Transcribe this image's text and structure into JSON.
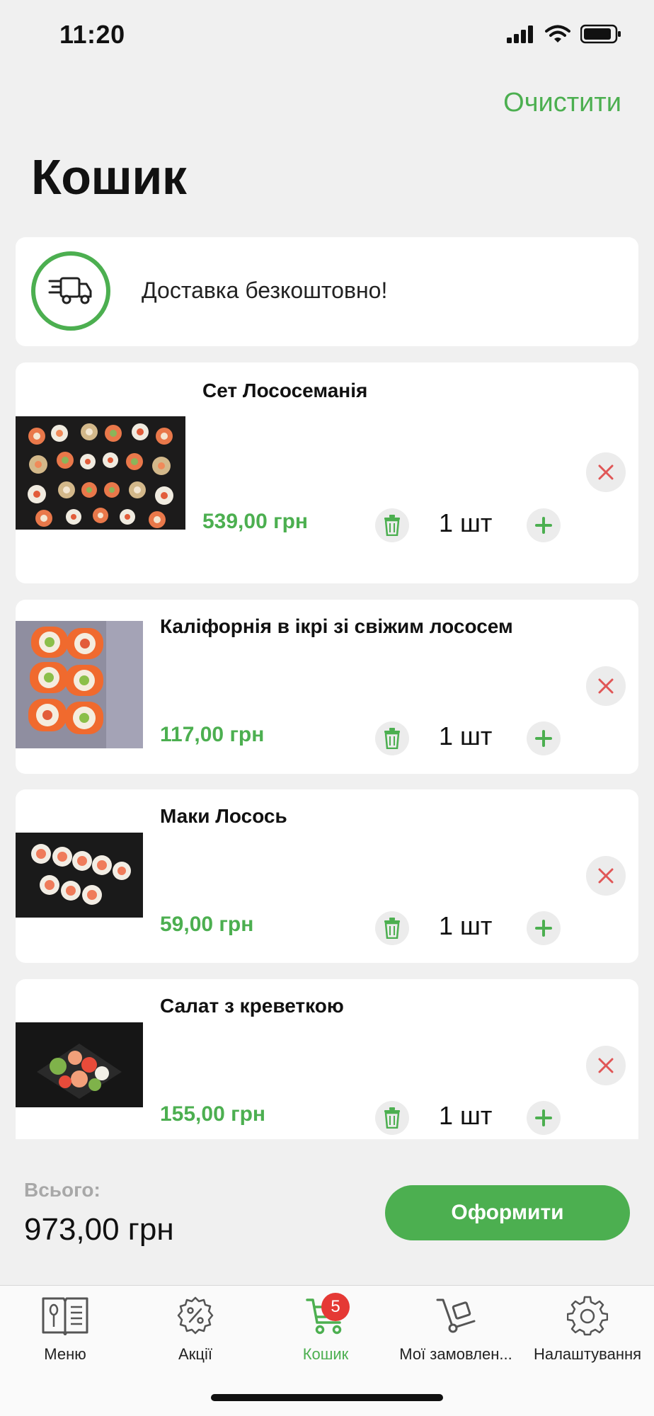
{
  "status_bar": {
    "time": "11:20"
  },
  "header": {
    "clear_label": "Очистити",
    "title": "Кошик"
  },
  "delivery": {
    "text": "Доставка безкоштовно!"
  },
  "items": [
    {
      "name": "Сет Лососеманія",
      "price": "539,00 грн",
      "quantity": "1 шт"
    },
    {
      "name": "Каліфорнія в ікрі  зі свіжим лососем",
      "price": "117,00 грн",
      "quantity": "1 шт"
    },
    {
      "name": "Маки Лосось",
      "price": "59,00 грн",
      "quantity": "1 шт"
    },
    {
      "name": "Салат з креветкою",
      "price": "155,00 грн",
      "quantity": "1 шт"
    }
  ],
  "summary": {
    "total_label": "Всього:",
    "total_value": "973,00 грн",
    "checkout_label": "Оформити"
  },
  "tabs": [
    {
      "label": "Меню",
      "icon": "menu-book-icon"
    },
    {
      "label": "Акції",
      "icon": "discount-icon"
    },
    {
      "label": "Кошик",
      "icon": "cart-icon",
      "active": true,
      "badge": "5"
    },
    {
      "label": "Мої замовлен...",
      "icon": "dolly-icon"
    },
    {
      "label": "Налаштування",
      "icon": "gear-icon"
    }
  ],
  "colors": {
    "accent": "#4caf50",
    "badge": "#e53935",
    "remove": "#e05656"
  }
}
